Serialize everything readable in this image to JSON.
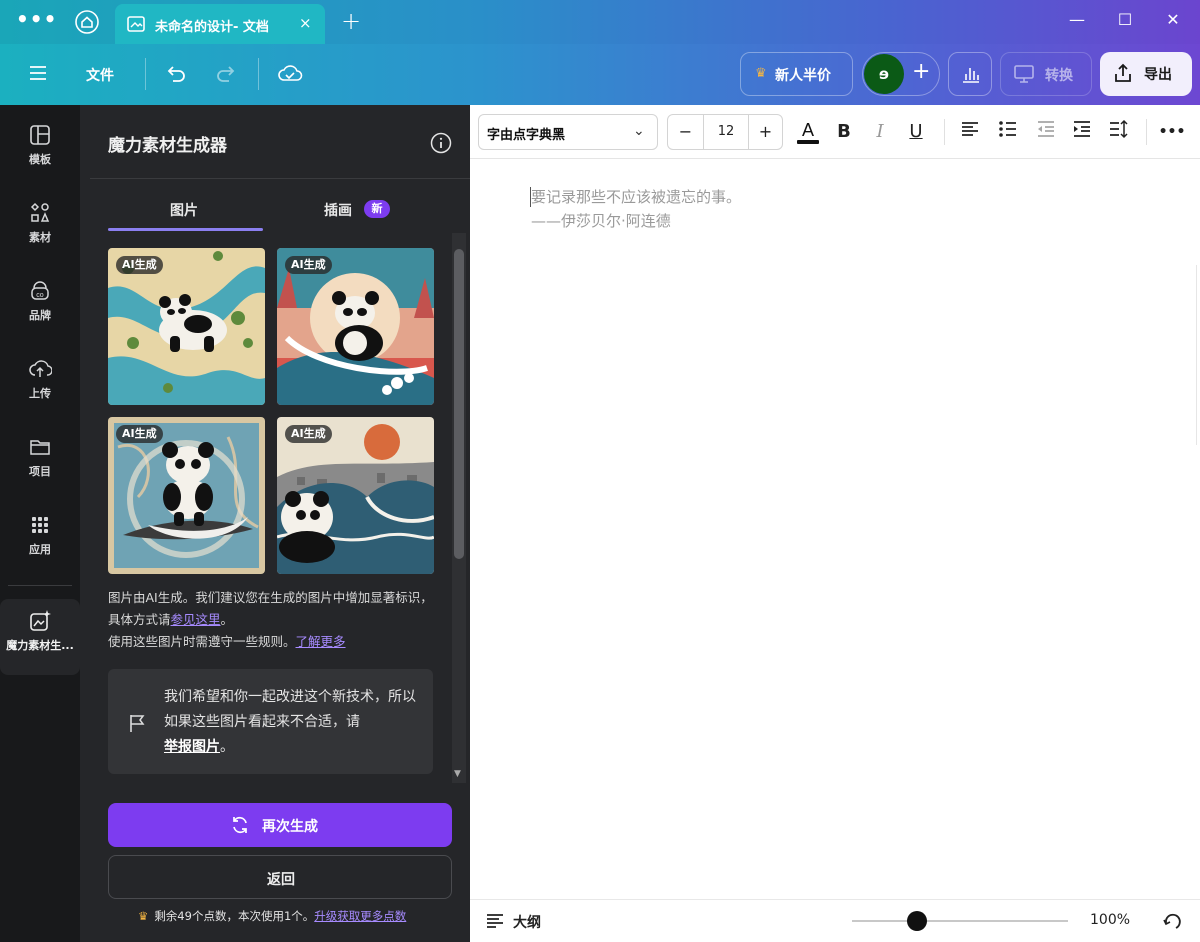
{
  "titlebar": {
    "tab_title": "未命名的设计- 文档",
    "menu_dots": "•••",
    "close_tab": "×",
    "new_tab": "+",
    "minimize": "—",
    "maximize": "☐",
    "close_window": "✕"
  },
  "toolbar": {
    "file_label": "文件",
    "promo_label": "新人半价",
    "avatar_initial": "ɘ",
    "convert_label": "转换",
    "export_label": "导出",
    "brand_accent": "#7d3cf0"
  },
  "rail": {
    "items": [
      {
        "label": "模板",
        "icon": "template-icon"
      },
      {
        "label": "素材",
        "icon": "elements-icon"
      },
      {
        "label": "品牌",
        "icon": "brand-icon"
      },
      {
        "label": "上传",
        "icon": "upload-icon"
      },
      {
        "label": "项目",
        "icon": "folder-icon"
      },
      {
        "label": "应用",
        "icon": "apps-icon"
      },
      {
        "label": "魔力素材生...",
        "icon": "magic-media-icon",
        "active": true
      }
    ]
  },
  "panel": {
    "title": "魔力素材生成器",
    "tabs": [
      {
        "label": "图片",
        "active": true
      },
      {
        "label": "插画",
        "badge": "新"
      }
    ],
    "ai_badge": "AI生成",
    "images": [
      {
        "subject": "panda on river map"
      },
      {
        "subject": "panda surfing sunset"
      },
      {
        "subject": "panda on board vintage"
      },
      {
        "subject": "panda great wave"
      }
    ],
    "disclaimer_1": "图片由AI生成。我们建议您在生成的图片中增加显著标识，具体方式请",
    "disclaimer_link_1": "参见这里",
    "disclaimer_period": "。",
    "disclaimer_2": "使用这些图片时需遵守一些规则。",
    "disclaimer_link_2": "了解更多",
    "feedback_text": "我们希望和你一起改进这个新技术，所以如果这些图片看起来不合适，请",
    "feedback_link": "举报图片",
    "feedback_end": "。",
    "regenerate_label": "再次生成",
    "back_label": "返回",
    "credits_text": "剩余49个点数，本次使用1个。",
    "credits_link": "升级获取更多点数",
    "crown": "♛"
  },
  "format": {
    "font_name": "字由点字典黑",
    "font_size": "12",
    "minus": "−",
    "plus": "+",
    "bold": "B",
    "italic": "I",
    "underline": "U",
    "text_color_glyph": "A",
    "more": "•••"
  },
  "document": {
    "line1": "要记录那些不应该被遗忘的事。",
    "line2": "——伊莎贝尔·阿连德"
  },
  "bottom": {
    "outline_label": "大纲",
    "zoom_value": "100%",
    "zoom_level": 0.3
  }
}
